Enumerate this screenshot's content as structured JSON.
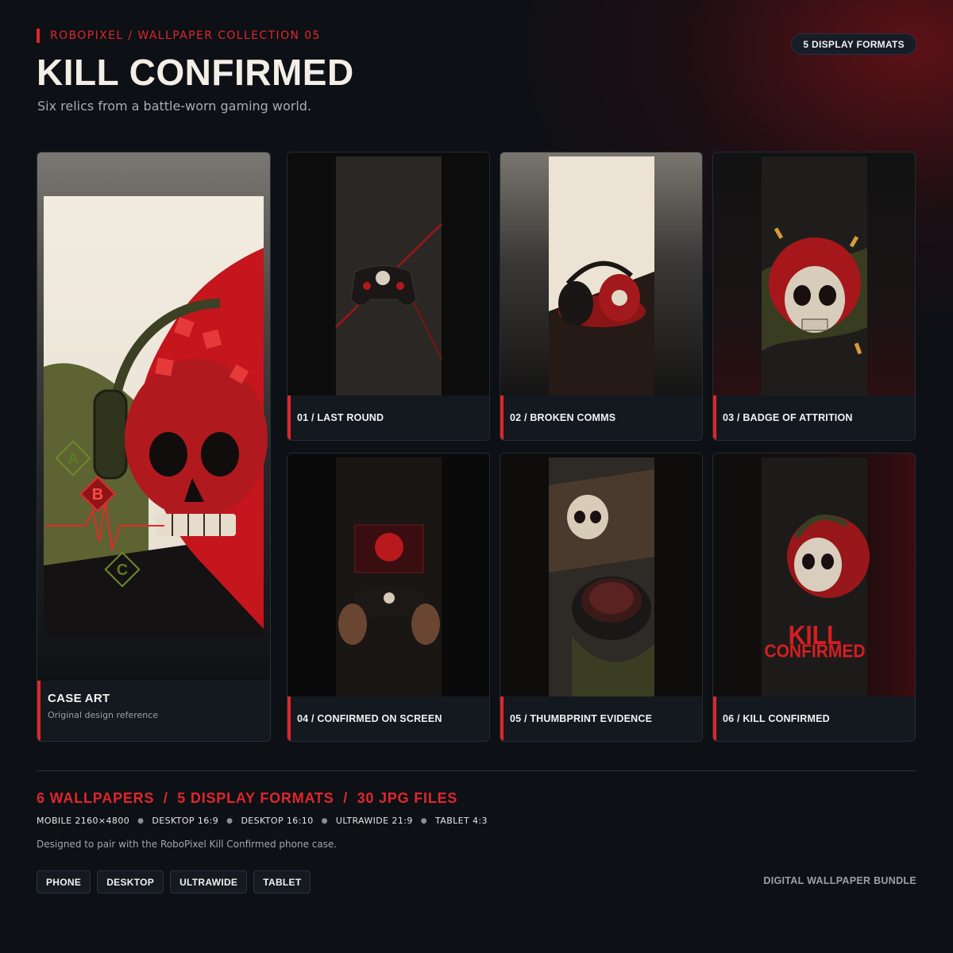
{
  "header": {
    "eyebrow": "ROBOPIXEL / WALLPAPER COLLECTION 05",
    "title": "KILL CONFIRMED",
    "subtitle": "Six relics from a battle-worn gaming world.",
    "format_badge": "5 DISPLAY FORMATS"
  },
  "hero": {
    "title": "CASE ART",
    "subtitle": "Original design reference",
    "overlay_letters": [
      "A",
      "B",
      "C"
    ]
  },
  "cards": [
    {
      "label": "01 / LAST ROUND"
    },
    {
      "label": "02 / BROKEN COMMS"
    },
    {
      "label": "03 / BADGE OF ATTRITION"
    },
    {
      "label": "04 / CONFIRMED ON SCREEN"
    },
    {
      "label": "05 / THUMBPRINT EVIDENCE"
    },
    {
      "label": "06 / KILL CONFIRMED",
      "art_text": [
        "KILL",
        "CONFIRMED"
      ]
    }
  ],
  "footer": {
    "stats": "6 WALLPAPERS  /  5 DISPLAY FORMATS  /  30 JPG FILES",
    "specs": [
      "MOBILE 2160×4800",
      "DESKTOP 16:9",
      "DESKTOP 16:10",
      "ULTRAWIDE 21:9",
      "TABLET 4:3"
    ],
    "note": "Designed to pair with the RoboPixel Kill Confirmed phone case.",
    "chips": [
      "PHONE",
      "DESKTOP",
      "ULTRAWIDE",
      "TABLET"
    ],
    "bundle_label": "DIGITAL WALLPAPER BUNDLE"
  },
  "colors": {
    "accent": "#e0262b",
    "background": "#0d1015",
    "caption_bg": "#141920"
  }
}
